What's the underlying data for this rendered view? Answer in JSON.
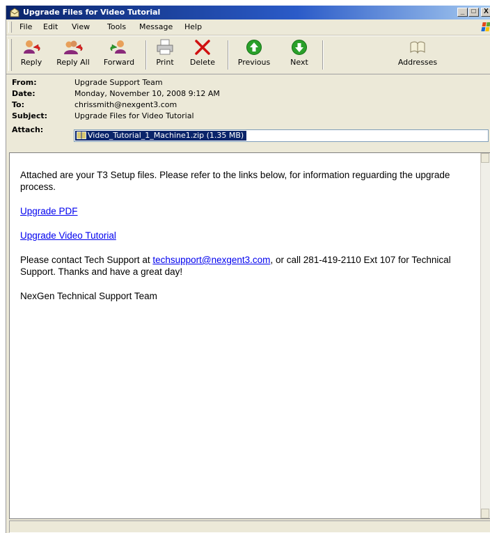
{
  "window": {
    "title": "Upgrade Files for Video Tutorial"
  },
  "window_controls": {
    "minimize": "_",
    "maximize": "□",
    "close": "X"
  },
  "menu": [
    "File",
    "Edit",
    "View",
    "Tools",
    "Message",
    "Help"
  ],
  "toolbar": {
    "reply": "Reply",
    "reply_all": "Reply All",
    "forward": "Forward",
    "print": "Print",
    "delete": "Delete",
    "previous": "Previous",
    "next": "Next",
    "addresses": "Addresses"
  },
  "header": {
    "from_label": "From:",
    "from": "Upgrade Support Team",
    "date_label": "Date:",
    "date": "Monday, November 10, 2008 9:12 AM",
    "to_label": "To:",
    "to": "chrissmith@nexgent3.com",
    "subject_label": "Subject:",
    "subject": "Upgrade Files for Video Tutorial",
    "attach_label": "Attach:",
    "attachment": "Video_Tutorial_1_Machine1.zip (1.35 MB)"
  },
  "body": {
    "intro": "Attached are your T3 Setup files. Please refer to the links below, for information reguarding the upgrade process.",
    "link_pdf": "Upgrade PDF",
    "link_video": "Upgrade Video Tutorial",
    "contact_pre": "Please contact Tech Support at ",
    "contact_email": "techsupport@nexgent3.com",
    "contact_post": ", or call 281-419-2110 Ext 107 for Technical Support. Thanks and have a great day!",
    "signature": "NexGen Technical Support Team"
  },
  "colors": {
    "title_bar": "#0a246a",
    "link": "#0000ee",
    "selection": "#0a246a",
    "chrome": "#ece9d8"
  }
}
